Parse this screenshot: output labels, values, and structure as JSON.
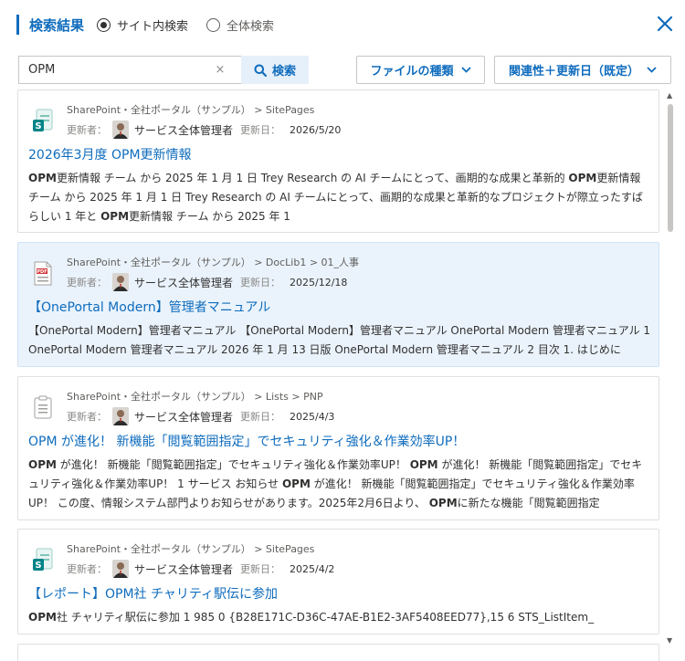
{
  "header": {
    "title": "検索結果",
    "scope_site": "サイト内検索",
    "scope_all": "全体検索",
    "selected_scope": "site"
  },
  "search": {
    "value": "OPM",
    "clear_label": "×",
    "button_label": "検索"
  },
  "filters": {
    "file_type_label": "ファイルの種類",
    "sort_label": "関連性＋更新日（既定）"
  },
  "meta_labels": {
    "updater": "更新者：",
    "updated": "更新日："
  },
  "results": [
    {
      "icon": "sharepoint-page-icon",
      "path": "SharePoint・全社ポータル（サンプル） > SitePages",
      "author": "サービス全体管理者",
      "date": "2026/5/20",
      "title": "2026年3月度 OPM更新情報",
      "snippet_html": "<b>OPM</b>更新情報 チーム から 2025 年 1 月 1 日 Trey Research の AI チームにとって、画期的な成果と革新的 <b>OPM</b>更新情報 チーム から 2025 年 1 月 1 日 Trey Research の AI チームにとって、画期的な成果と革新的なプロジェクトが際立ったすばらしい 1 年と <b>OPM</b>更新情報 チーム から 2025 年 1"
    },
    {
      "icon": "pdf-icon",
      "path": "SharePoint・全社ポータル（サンプル） > DocLib1 > 01_人事",
      "author": "サービス全体管理者",
      "date": "2025/12/18",
      "title": "【OnePortal Modern】管理者マニュアル",
      "snippet_html": "【OnePortal Modern】管理者マニュアル 【OnePortal Modern】管理者マニュアル OnePortal Modern 管理者マニュアル 1 OnePortal Modern 管理者マニュアル 2026 年 1 月 13 日版 OnePortal Modern 管理者マニュアル 2 目次 1. はじめに"
    },
    {
      "icon": "list-item-icon",
      "path": "SharePoint・全社ポータル（サンプル） > Lists > PNP",
      "author": "サービス全体管理者",
      "date": "2025/4/3",
      "title": "OPM が進化！ 新機能「閲覧範囲指定」でセキュリティ強化＆作業効率UP！",
      "snippet_html": "<b>OPM</b> が進化！ 新機能「閲覧範囲指定」でセキュリティ強化＆作業効率UP！ <b>OPM</b> が進化！ 新機能「閲覧範囲指定」でセキュリティ強化＆作業効率UP！ 1 サービス お知らせ <b>OPM</b> が進化！ 新機能「閲覧範囲指定」でセキュリティ強化＆作業効率UP！ この度、情報システム部門よりお知らせがあります。2025年2月6日より、 <b>OPM</b>に新たな機能「閲覧範囲指定"
    },
    {
      "icon": "sharepoint-page-icon",
      "path": "SharePoint・全社ポータル（サンプル） > SitePages",
      "author": "サービス全体管理者",
      "date": "2025/4/2",
      "title": "【レポート】OPM社 チャリティ駅伝に参加",
      "snippet_html": "<b>OPM</b>社 チャリティ駅伝に参加 1 985 0 {B28E171C-D36C-47AE-B1E2-3AF5408EED77},15 6 STS_ListItem_"
    }
  ],
  "colors": {
    "accent": "#0f6cbd",
    "highlight_bg": "#eaf3fc",
    "border": "#e1dfdd"
  }
}
